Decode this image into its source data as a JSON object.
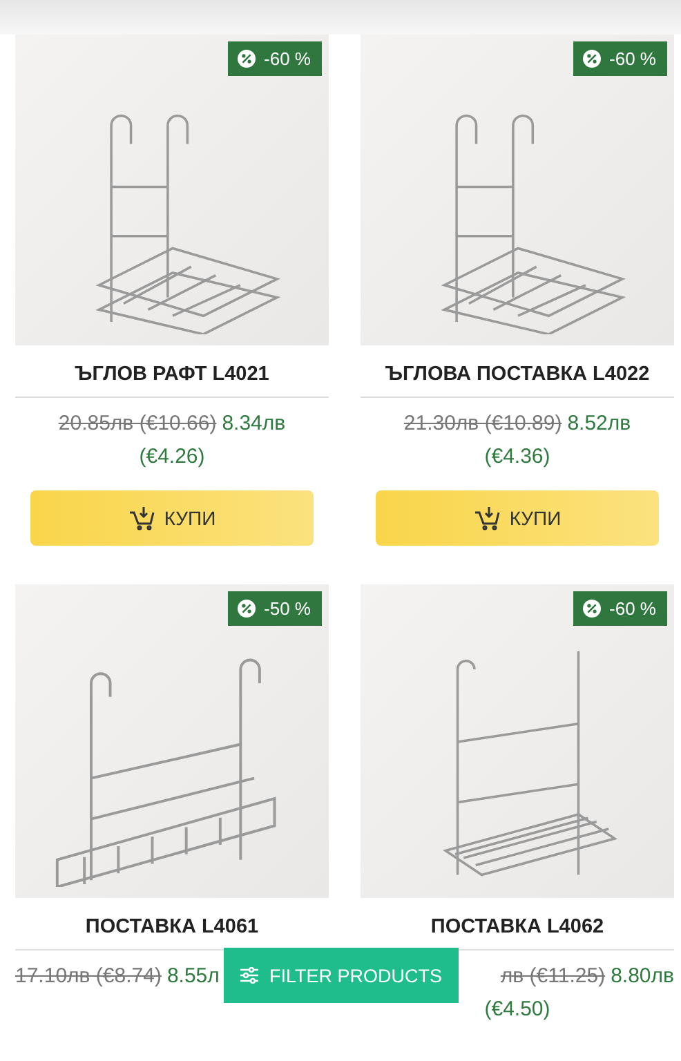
{
  "products": [
    {
      "kind": "corner",
      "discount": "-60 %",
      "name": "ЪГЛОВ РАФТ L4021",
      "old_price": "20.85лв (€10.66)",
      "new_price": "8.34лв",
      "new_price_eur": "(€4.26)",
      "buy_label": "КУПИ"
    },
    {
      "kind": "corner",
      "discount": "-60 %",
      "name": "ЪГЛОВА ПОСТАВКА L4022",
      "old_price": "21.30лв (€10.89)",
      "new_price": "8.52лв",
      "new_price_eur": "(€4.36)",
      "buy_label": "КУПИ"
    },
    {
      "kind": "rail",
      "discount": "-50 %",
      "name": "ПОСТАВКА L4061",
      "old_price": "17.10лв (€8.74)",
      "new_price": "8.55л"
    },
    {
      "kind": "shelf",
      "discount": "-60 %",
      "name": "ПОСТАВКА L4062",
      "old_price": "лв (€11.25)",
      "new_price": "8.80лв",
      "new_price_eur": "(€4.50)"
    }
  ],
  "filter_button": {
    "label": "FILTER PRODUCTS"
  }
}
